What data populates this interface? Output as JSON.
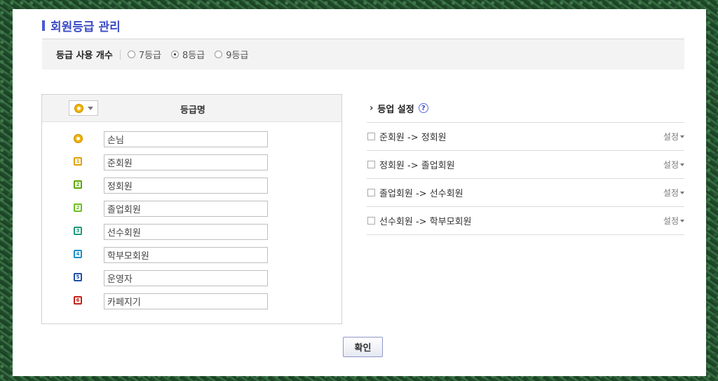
{
  "page": {
    "title": "회원등급 관리"
  },
  "grade_count": {
    "label": "등급 사용 개수",
    "options": [
      {
        "label": "7등급",
        "selected": false
      },
      {
        "label": "8등급",
        "selected": true
      },
      {
        "label": "9등급",
        "selected": false
      }
    ]
  },
  "grade_table": {
    "header": "등급명",
    "rows": [
      {
        "icon": "smiley-icon",
        "name": "손님"
      },
      {
        "icon": "grade-1-icon",
        "badge": "1",
        "color": "#e0a100",
        "name": "준회원"
      },
      {
        "icon": "grade-2-icon",
        "badge": "2",
        "color": "#5aa800",
        "name": "정회원"
      },
      {
        "icon": "grade-2-icon",
        "badge": "2",
        "color": "#6bbf1e",
        "name": "졸업회원"
      },
      {
        "icon": "grade-3-icon",
        "badge": "3",
        "color": "#1e9a7a",
        "name": "선수회원"
      },
      {
        "icon": "grade-4-icon",
        "badge": "4",
        "color": "#1b8fc7",
        "name": "학부모회원"
      },
      {
        "icon": "grade-5-icon",
        "badge": "5",
        "color": "#1f4fa8",
        "name": "운영자"
      },
      {
        "icon": "grade-6-icon",
        "badge": "6",
        "color": "#c8201c",
        "name": "카페지기"
      }
    ]
  },
  "levelup": {
    "title": "등업 설정",
    "help": "?",
    "rows": [
      {
        "label": "준회원 -> 정회원",
        "setting": "설정"
      },
      {
        "label": "정회원 -> 졸업회원",
        "setting": "설정"
      },
      {
        "label": "졸업회원 -> 선수회원",
        "setting": "설정"
      },
      {
        "label": "선수회원 -> 학부모회원",
        "setting": "설정"
      }
    ]
  },
  "confirm_label": "확인"
}
